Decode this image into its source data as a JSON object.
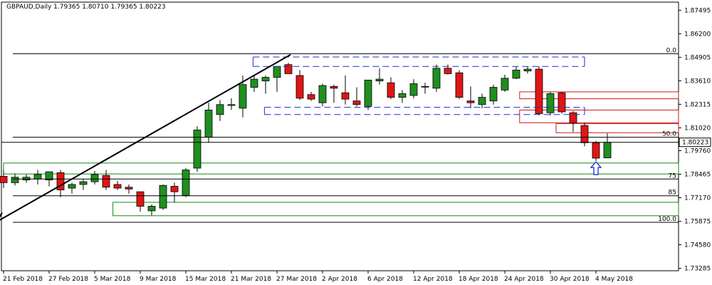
{
  "chart_data": {
    "type": "candlestick",
    "symbol_line": "GBPAUD,Daily  1.79365 1.80710 1.79365 1.80223",
    "current_price": "1.80223",
    "y_range": [
      1.7315,
      1.8794
    ],
    "y_ticks": [
      "1.87495",
      "1.86200",
      "1.84905",
      "1.83610",
      "1.82315",
      "1.81020",
      "1.79760",
      "1.78465",
      "1.77170",
      "1.75875",
      "1.74580",
      "1.73285"
    ],
    "x_ticks": [
      {
        "label": "21 Feb 2018",
        "index": 0
      },
      {
        "label": "27 Feb 2018",
        "index": 4
      },
      {
        "label": "5 Mar 2018",
        "index": 8
      },
      {
        "label": "9 Mar 2018",
        "index": 12
      },
      {
        "label": "15 Mar 2018",
        "index": 16
      },
      {
        "label": "21 Mar 2018",
        "index": 20
      },
      {
        "label": "27 Mar 2018",
        "index": 24
      },
      {
        "label": "2 Apr 2018",
        "index": 28
      },
      {
        "label": "6 Apr 2018",
        "index": 32
      },
      {
        "label": "12 Apr 2018",
        "index": 36
      },
      {
        "label": "18 Apr 2018",
        "index": 40
      },
      {
        "label": "24 Apr 2018",
        "index": 44
      },
      {
        "label": "30 Apr 2018",
        "index": 48
      },
      {
        "label": "4 May 2018",
        "index": 52
      }
    ],
    "candles": [
      {
        "o": 1.7835,
        "h": 1.787,
        "l": 1.777,
        "c": 1.78
      },
      {
        "o": 1.78,
        "h": 1.785,
        "l": 1.7785,
        "c": 1.783
      },
      {
        "o": 1.7815,
        "h": 1.7845,
        "l": 1.78,
        "c": 1.783
      },
      {
        "o": 1.782,
        "h": 1.787,
        "l": 1.779,
        "c": 1.7845
      },
      {
        "o": 1.7815,
        "h": 1.786,
        "l": 1.778,
        "c": 1.786
      },
      {
        "o": 1.7855,
        "h": 1.787,
        "l": 1.772,
        "c": 1.776
      },
      {
        "o": 1.777,
        "h": 1.78,
        "l": 1.774,
        "c": 1.779
      },
      {
        "o": 1.779,
        "h": 1.782,
        "l": 1.776,
        "c": 1.7805
      },
      {
        "o": 1.7805,
        "h": 1.7865,
        "l": 1.779,
        "c": 1.7845
      },
      {
        "o": 1.784,
        "h": 1.787,
        "l": 1.776,
        "c": 1.7775
      },
      {
        "o": 1.779,
        "h": 1.781,
        "l": 1.776,
        "c": 1.777
      },
      {
        "o": 1.7775,
        "h": 1.779,
        "l": 1.774,
        "c": 1.7765
      },
      {
        "o": 1.775,
        "h": 1.775,
        "l": 1.764,
        "c": 1.767
      },
      {
        "o": 1.7645,
        "h": 1.768,
        "l": 1.762,
        "c": 1.767
      },
      {
        "o": 1.766,
        "h": 1.779,
        "l": 1.765,
        "c": 1.7785
      },
      {
        "o": 1.778,
        "h": 1.78,
        "l": 1.769,
        "c": 1.775
      },
      {
        "o": 1.773,
        "h": 1.788,
        "l": 1.772,
        "c": 1.787
      },
      {
        "o": 1.788,
        "h": 1.811,
        "l": 1.786,
        "c": 1.809
      },
      {
        "o": 1.805,
        "h": 1.824,
        "l": 1.802,
        "c": 1.82
      },
      {
        "o": 1.8175,
        "h": 1.8255,
        "l": 1.814,
        "c": 1.823
      },
      {
        "o": 1.8225,
        "h": 1.8265,
        "l": 1.82,
        "c": 1.823
      },
      {
        "o": 1.821,
        "h": 1.839,
        "l": 1.816,
        "c": 1.834
      },
      {
        "o": 1.8325,
        "h": 1.839,
        "l": 1.83,
        "c": 1.837
      },
      {
        "o": 1.836,
        "h": 1.839,
        "l": 1.829,
        "c": 1.838
      },
      {
        "o": 1.838,
        "h": 1.844,
        "l": 1.83,
        "c": 1.844
      },
      {
        "o": 1.845,
        "h": 1.846,
        "l": 1.84,
        "c": 1.84
      },
      {
        "o": 1.839,
        "h": 1.842,
        "l": 1.8255,
        "c": 1.8265
      },
      {
        "o": 1.8285,
        "h": 1.83,
        "l": 1.825,
        "c": 1.826
      },
      {
        "o": 1.824,
        "h": 1.8345,
        "l": 1.822,
        "c": 1.8335
      },
      {
        "o": 1.833,
        "h": 1.834,
        "l": 1.824,
        "c": 1.832
      },
      {
        "o": 1.8295,
        "h": 1.839,
        "l": 1.823,
        "c": 1.826
      },
      {
        "o": 1.825,
        "h": 1.8325,
        "l": 1.822,
        "c": 1.823
      },
      {
        "o": 1.822,
        "h": 1.836,
        "l": 1.82,
        "c": 1.8365
      },
      {
        "o": 1.836,
        "h": 1.843,
        "l": 1.834,
        "c": 1.837
      },
      {
        "o": 1.835,
        "h": 1.838,
        "l": 1.826,
        "c": 1.827
      },
      {
        "o": 1.827,
        "h": 1.831,
        "l": 1.824,
        "c": 1.829
      },
      {
        "o": 1.828,
        "h": 1.837,
        "l": 1.8265,
        "c": 1.8345
      },
      {
        "o": 1.833,
        "h": 1.835,
        "l": 1.829,
        "c": 1.833
      },
      {
        "o": 1.832,
        "h": 1.845,
        "l": 1.83,
        "c": 1.843
      },
      {
        "o": 1.843,
        "h": 1.845,
        "l": 1.8395,
        "c": 1.84
      },
      {
        "o": 1.8405,
        "h": 1.842,
        "l": 1.826,
        "c": 1.827
      },
      {
        "o": 1.825,
        "h": 1.833,
        "l": 1.821,
        "c": 1.824
      },
      {
        "o": 1.823,
        "h": 1.829,
        "l": 1.821,
        "c": 1.827
      },
      {
        "o": 1.825,
        "h": 1.834,
        "l": 1.823,
        "c": 1.8325
      },
      {
        "o": 1.831,
        "h": 1.8395,
        "l": 1.83,
        "c": 1.8375
      },
      {
        "o": 1.8375,
        "h": 1.844,
        "l": 1.837,
        "c": 1.842
      },
      {
        "o": 1.8415,
        "h": 1.844,
        "l": 1.84,
        "c": 1.8425
      },
      {
        "o": 1.8425,
        "h": 1.844,
        "l": 1.817,
        "c": 1.818
      },
      {
        "o": 1.8185,
        "h": 1.83,
        "l": 1.817,
        "c": 1.829
      },
      {
        "o": 1.8295,
        "h": 1.83,
        "l": 1.818,
        "c": 1.819
      },
      {
        "o": 1.8185,
        "h": 1.8195,
        "l": 1.808,
        "c": 1.813
      },
      {
        "o": 1.8115,
        "h": 1.813,
        "l": 1.8,
        "c": 1.802
      },
      {
        "o": 1.802,
        "h": 1.803,
        "l": 1.792,
        "c": 1.7935
      },
      {
        "o": 1.79365,
        "h": 1.8071,
        "l": 1.79365,
        "c": 1.80223
      }
    ],
    "annotations": {
      "fib_labels": [
        "0.0",
        "50.0",
        "75",
        "85",
        "100.0"
      ],
      "trendline": {
        "from": {
          "index": -0.6,
          "price": 1.7585
        },
        "to": {
          "index": 25.2,
          "price": 1.8505
        }
      },
      "fib_lines": [
        {
          "label": "0.0",
          "price": 1.851
        },
        {
          "label": "50.0",
          "price": 1.805
        },
        {
          "label": "75",
          "price": 1.782
        },
        {
          "label": "85",
          "price": 1.7728
        },
        {
          "label": "100.0",
          "price": 1.7582
        }
      ],
      "blue_channel_top": {
        "start": 21.9,
        "end": 51,
        "lines": [
          1.8492,
          1.844
        ]
      },
      "blue_channel_bottom": {
        "start": 22.9,
        "end": 51,
        "lines": [
          1.8215,
          1.8175
        ]
      },
      "green_zones": [
        {
          "start": 0,
          "end": 60,
          "top": 1.7908,
          "bottom": 1.7848
        },
        {
          "start": 9.6,
          "end": 60,
          "top": 1.7692,
          "bottom": 1.7618
        }
      ],
      "red_zones": [
        {
          "start": 45.3,
          "end": 60,
          "top": 1.83,
          "bottom": 1.8262
        },
        {
          "start": 45.3,
          "end": 60,
          "top": 1.82,
          "bottom": 1.813
        },
        {
          "start": 48.5,
          "end": 60,
          "top": 1.8125,
          "bottom": 1.8075
        }
      ],
      "arrow": {
        "index": 52,
        "price": 1.786
      }
    },
    "colors": {
      "bull": "#1f8f1f",
      "bear": "#e01515",
      "channel": "#1a2fd0",
      "zone_green": "#138a13",
      "zone_red": "#d01818"
    }
  }
}
